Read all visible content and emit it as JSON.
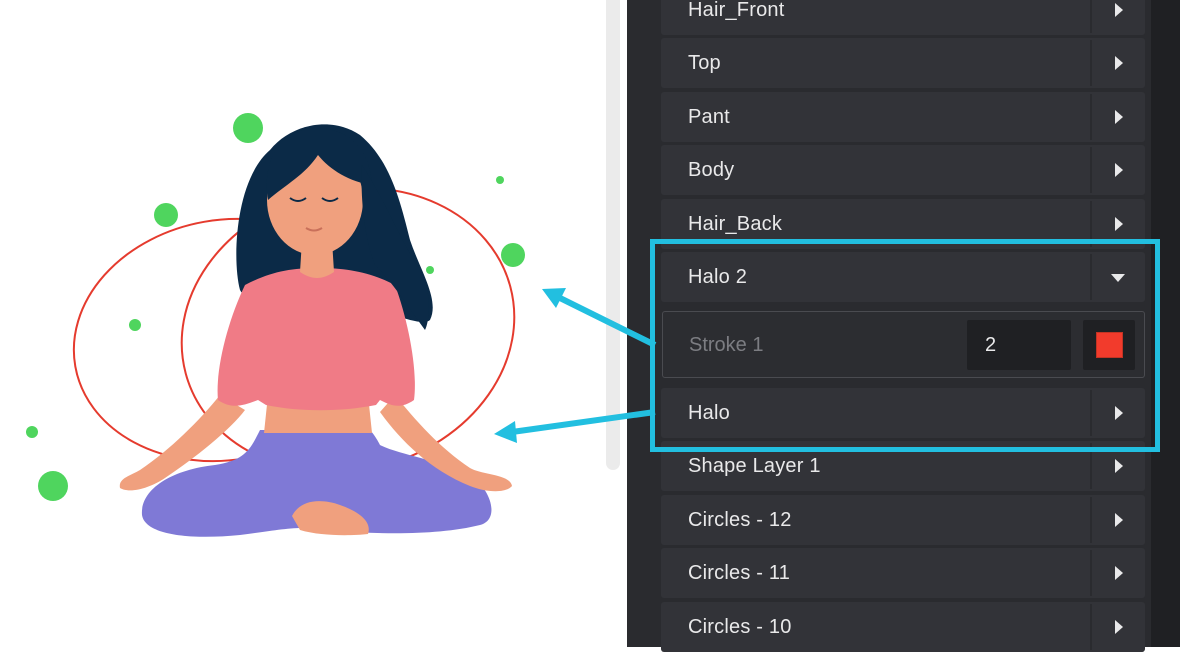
{
  "layers_panel": {
    "rows": [
      {
        "label": "Hair_Front",
        "state": "collapsed"
      },
      {
        "label": "Top",
        "state": "collapsed"
      },
      {
        "label": "Pant",
        "state": "collapsed"
      },
      {
        "label": "Body",
        "state": "collapsed"
      },
      {
        "label": "Hair_Back",
        "state": "collapsed"
      },
      {
        "label": "Halo 2",
        "state": "expanded"
      },
      {
        "label": "Halo",
        "state": "collapsed"
      },
      {
        "label": "Shape Layer 1",
        "state": "collapsed"
      },
      {
        "label": "Circles - 12",
        "state": "collapsed"
      },
      {
        "label": "Circles - 11",
        "state": "collapsed"
      },
      {
        "label": "Circles - 10",
        "state": "collapsed"
      }
    ],
    "stroke_property": {
      "label": "Stroke 1",
      "value": "2",
      "color": "#f23b2c"
    }
  },
  "colors": {
    "panel_bg": "#2a2b2f",
    "row_bg": "#323338",
    "highlight": "#22bfe0",
    "halo_stroke": "#e53b2e",
    "dot_green": "#4fd55e"
  }
}
